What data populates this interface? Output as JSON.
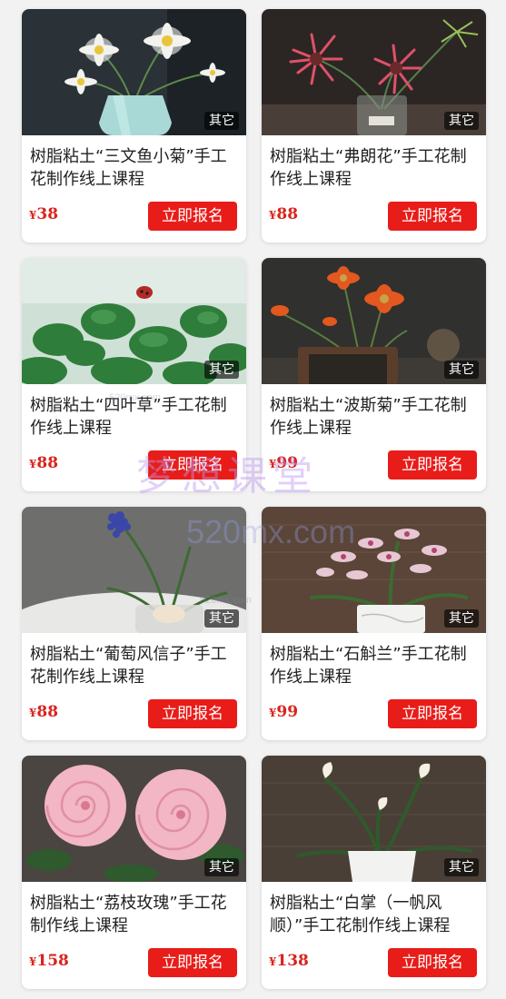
{
  "currency_symbol": "¥",
  "accent_color": "#e81c18",
  "price_color": "#d9231c",
  "watermark": {
    "main": "梦想课堂",
    "domain": "520mx.com",
    "small": "520mx.com"
  },
  "courses": [
    {
      "title": "树脂粘土“三文鱼小菊”手工花制作线上课程",
      "price": "38",
      "tag": "其它",
      "button": "立即报名",
      "image": "white-daisy-vase"
    },
    {
      "title": "树脂粘土“弗朗花”手工花制作线上课程",
      "price": "88",
      "tag": "其它",
      "button": "立即报名",
      "image": "pink-gerbera-jar"
    },
    {
      "title": "树脂粘土“四叶草”手工花制作线上课程",
      "price": "88",
      "tag": "其它",
      "button": "立即报名",
      "image": "four-leaf-clover"
    },
    {
      "title": "树脂粘土“波斯菊”手工花制作线上课程",
      "price": "99",
      "tag": "其它",
      "button": "立即报名",
      "image": "orange-cosmos"
    },
    {
      "title": "树脂粘土“葡萄风信子”手工花制作线上课程",
      "price": "88",
      "tag": "其它",
      "button": "立即报名",
      "image": "grape-hyacinth"
    },
    {
      "title": "树脂粘土“石斛兰”手工花制作线上课程",
      "price": "99",
      "tag": "其它",
      "button": "立即报名",
      "image": "orchid-pot"
    },
    {
      "title": "树脂粘土“荔枝玫瑰”手工花制作线上课程",
      "price": "158",
      "tag": "其它",
      "button": "立即报名",
      "image": "pink-roses"
    },
    {
      "title": "树脂粘土“白掌（一帆风顺）”手工花制作线上课程",
      "price": "138",
      "tag": "其它",
      "button": "立即报名",
      "image": "peace-lily-pot"
    }
  ]
}
